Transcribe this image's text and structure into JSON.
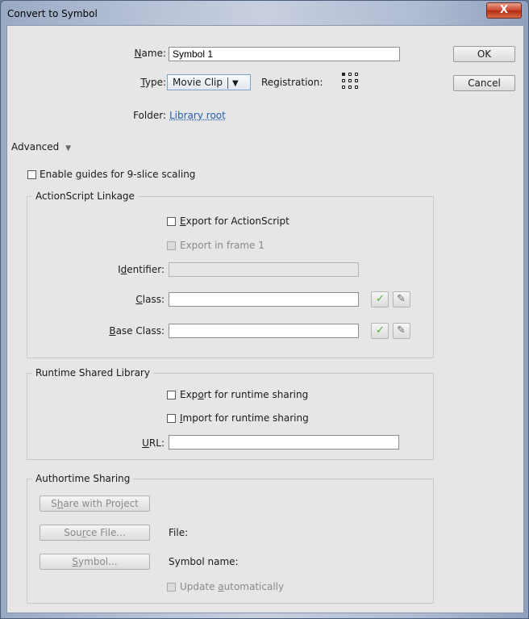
{
  "window": {
    "title": "Convert to Symbol",
    "close_label": "X"
  },
  "name": {
    "label": "Name:",
    "value": "Symbol 1"
  },
  "type": {
    "label": "Type:",
    "value": "Movie Clip",
    "registration_label": "Registration:"
  },
  "folder": {
    "label": "Folder:",
    "value": "Library root"
  },
  "advanced": {
    "label": "Advanced"
  },
  "buttons": {
    "ok": "OK",
    "cancel": "Cancel"
  },
  "guides": {
    "label": "Enable guides for 9-slice scaling"
  },
  "as_linkage": {
    "title": "ActionScript Linkage",
    "export_as": "Export for ActionScript",
    "export_frame1": "Export in frame 1",
    "identifier_label": "Identifier:",
    "class_label": "Class:",
    "base_class_label": "Base Class:"
  },
  "rsl": {
    "title": "Runtime Shared Library",
    "export_runtime": "Export for runtime sharing",
    "import_runtime": "Import for runtime sharing",
    "url_label": "URL:"
  },
  "authortime": {
    "title": "Authortime Sharing",
    "share_button": "Share with Project",
    "source_button": "Source File...",
    "file_label": "File:",
    "symbol_button": "Symbol...",
    "symbol_name_label": "Symbol name:",
    "update_auto": "Update automatically"
  },
  "colors": {
    "link": "#2860b0",
    "check": "#4caf2a"
  }
}
